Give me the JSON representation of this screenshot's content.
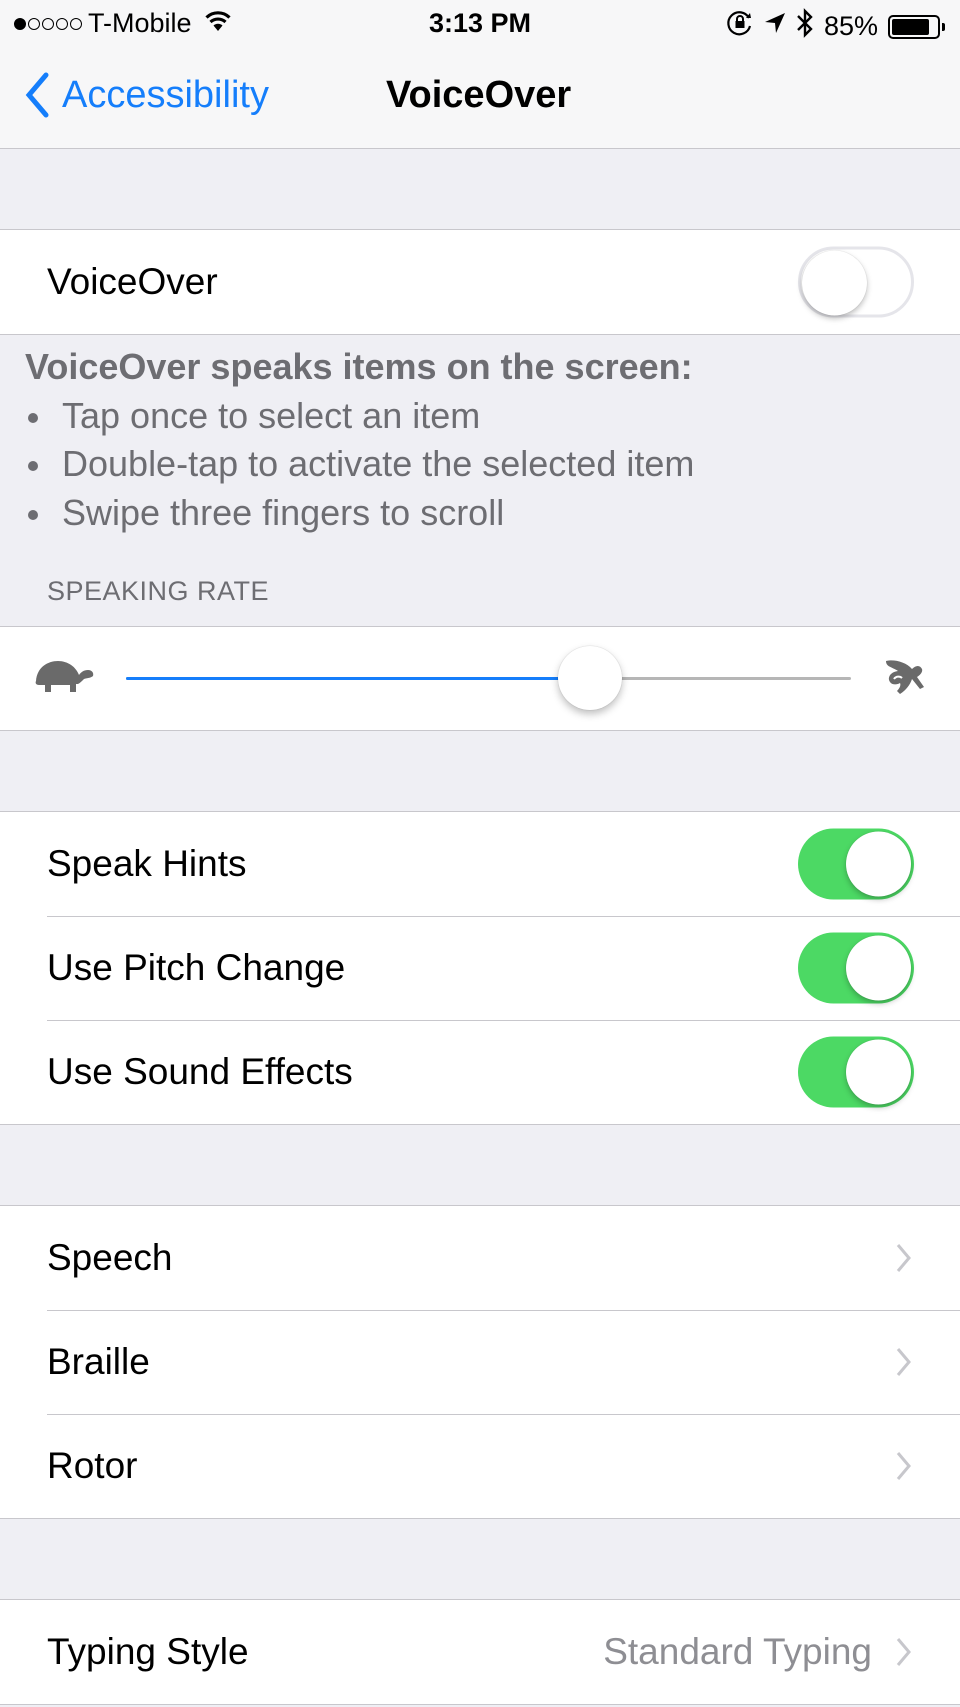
{
  "status_bar": {
    "signal_bars_filled": 1,
    "signal_bars_total": 5,
    "carrier": "T-Mobile",
    "wifi_icon": "wifi-icon",
    "time": "3:13 PM",
    "icons": [
      "orientation-lock-icon",
      "location-arrow-icon",
      "bluetooth-icon"
    ],
    "battery_percent": "85%",
    "battery_level": 0.85
  },
  "nav": {
    "back_label": "Accessibility",
    "title": "VoiceOver"
  },
  "voiceover": {
    "label": "VoiceOver",
    "enabled": false
  },
  "description": {
    "title": "VoiceOver speaks items on the screen:",
    "bullets": [
      "Tap once to select an item",
      "Double-tap to activate the selected item",
      "Swipe three fingers to scroll"
    ]
  },
  "speaking_rate": {
    "header": "SPEAKING RATE",
    "value": 0.64,
    "min_icon": "turtle-icon",
    "max_icon": "rabbit-icon"
  },
  "toggles": [
    {
      "label": "Speak Hints",
      "enabled": true
    },
    {
      "label": "Use Pitch Change",
      "enabled": true
    },
    {
      "label": "Use Sound Effects",
      "enabled": true
    }
  ],
  "nav_items": [
    {
      "label": "Speech"
    },
    {
      "label": "Braille"
    },
    {
      "label": "Rotor"
    }
  ],
  "typing_style": {
    "label": "Typing Style",
    "value": "Standard Typing"
  },
  "colors": {
    "accent": "#157efb",
    "switch_on": "#4cd964",
    "background": "#efeff4",
    "secondary_text": "#6d6d72"
  }
}
